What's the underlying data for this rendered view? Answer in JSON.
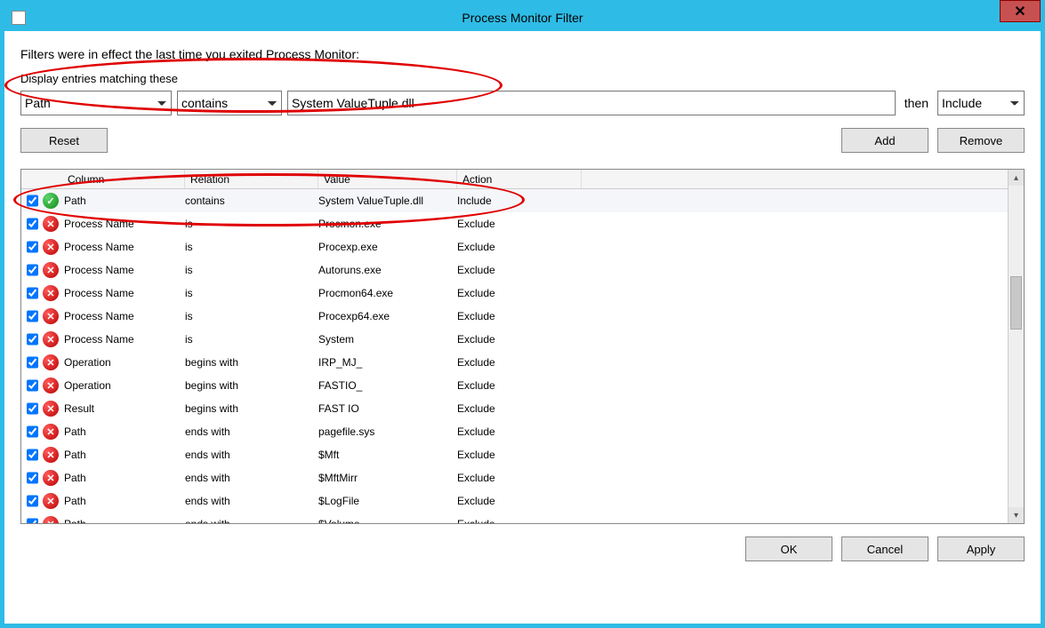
{
  "window": {
    "title": "Process Monitor Filter"
  },
  "intro": "Filters were in effect the last time you exited Process Monitor:",
  "prompt": "Display entries matching these",
  "filter": {
    "column": "Path",
    "relation": "contains",
    "value": "System ValueTuple.dll",
    "then_label": "then",
    "action": "Include"
  },
  "buttons": {
    "reset": "Reset",
    "add": "Add",
    "remove": "Remove",
    "ok": "OK",
    "cancel": "Cancel",
    "apply": "Apply"
  },
  "grid": {
    "headers": {
      "column": "Column",
      "relation": "Relation",
      "value": "Value",
      "action": "Action"
    },
    "rows": [
      {
        "checked": true,
        "type": "include",
        "column": "Path",
        "relation": "contains",
        "value": "System ValueTuple.dll",
        "action": "Include"
      },
      {
        "checked": true,
        "type": "exclude",
        "column": "Process Name",
        "relation": "is",
        "value": "Procmon.exe",
        "action": "Exclude"
      },
      {
        "checked": true,
        "type": "exclude",
        "column": "Process Name",
        "relation": "is",
        "value": "Procexp.exe",
        "action": "Exclude"
      },
      {
        "checked": true,
        "type": "exclude",
        "column": "Process Name",
        "relation": "is",
        "value": "Autoruns.exe",
        "action": "Exclude"
      },
      {
        "checked": true,
        "type": "exclude",
        "column": "Process Name",
        "relation": "is",
        "value": "Procmon64.exe",
        "action": "Exclude"
      },
      {
        "checked": true,
        "type": "exclude",
        "column": "Process Name",
        "relation": "is",
        "value": "Procexp64.exe",
        "action": "Exclude"
      },
      {
        "checked": true,
        "type": "exclude",
        "column": "Process Name",
        "relation": "is",
        "value": "System",
        "action": "Exclude"
      },
      {
        "checked": true,
        "type": "exclude",
        "column": "Operation",
        "relation": "begins with",
        "value": "IRP_MJ_",
        "action": "Exclude"
      },
      {
        "checked": true,
        "type": "exclude",
        "column": "Operation",
        "relation": "begins with",
        "value": "FASTIO_",
        "action": "Exclude"
      },
      {
        "checked": true,
        "type": "exclude",
        "column": "Result",
        "relation": "begins with",
        "value": "FAST IO",
        "action": "Exclude"
      },
      {
        "checked": true,
        "type": "exclude",
        "column": "Path",
        "relation": "ends with",
        "value": "pagefile.sys",
        "action": "Exclude"
      },
      {
        "checked": true,
        "type": "exclude",
        "column": "Path",
        "relation": "ends with",
        "value": "$Mft",
        "action": "Exclude"
      },
      {
        "checked": true,
        "type": "exclude",
        "column": "Path",
        "relation": "ends with",
        "value": "$MftMirr",
        "action": "Exclude"
      },
      {
        "checked": true,
        "type": "exclude",
        "column": "Path",
        "relation": "ends with",
        "value": "$LogFile",
        "action": "Exclude"
      },
      {
        "checked": true,
        "type": "exclude",
        "column": "Path",
        "relation": "ends with",
        "value": "$Volume",
        "action": "Exclude"
      }
    ]
  }
}
